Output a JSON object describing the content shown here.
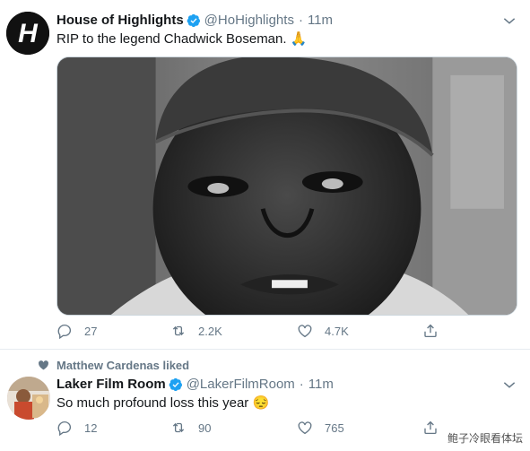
{
  "tweets": [
    {
      "display_name": "House of Highlights",
      "handle": "@HoHighlights",
      "separator": "·",
      "time": "11m",
      "text": "RIP to the legend Chadwick Boseman. 🙏",
      "counts": {
        "replies": "27",
        "retweets": "2.2K",
        "likes": "4.7K"
      },
      "avatar_letter": "H"
    },
    {
      "social_context": "Matthew Cardenas liked",
      "display_name": "Laker Film Room",
      "handle": "@LakerFilmRoom",
      "separator": "·",
      "time": "11m",
      "text": "So much profound loss this year 😔",
      "counts": {
        "replies": "12",
        "retweets": "90",
        "likes": "765"
      }
    }
  ],
  "icons": {
    "verified": "verified-badge-icon",
    "caret": "chevron-down-icon",
    "reply": "reply-icon",
    "retweet": "retweet-icon",
    "like": "heart-icon",
    "share": "share-icon"
  },
  "colors": {
    "verified": "#1da1f2",
    "muted": "#657786",
    "text": "#14171a"
  },
  "watermark": "鲍子冷眼看体坛"
}
